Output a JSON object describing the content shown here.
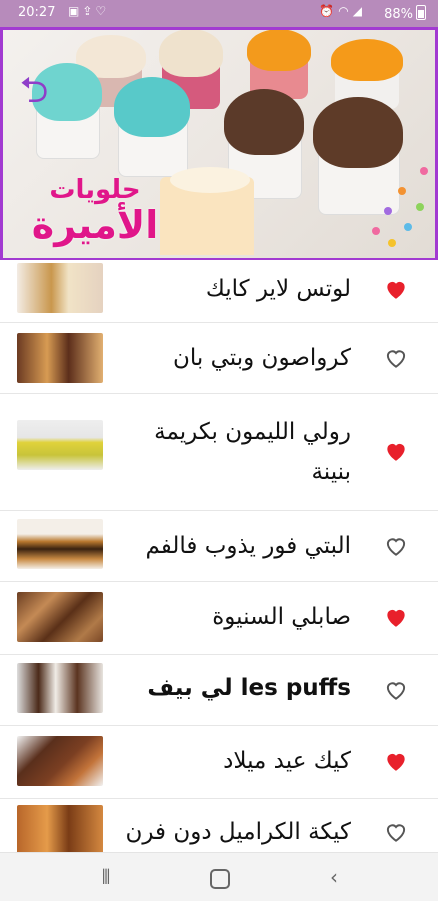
{
  "status_bar": {
    "time": "20:27",
    "left_icons": [
      "image-icon",
      "upload-icon",
      "shield-icon"
    ],
    "right_icons": [
      "alarm-icon",
      "wifi-icon",
      "signal-icon"
    ],
    "battery": "88%"
  },
  "header": {
    "logo_line1": "حلويات",
    "logo_line2": "الأميرة",
    "accent_color": "#a23ad1",
    "logo_color": "#e0168a"
  },
  "recipes": [
    {
      "title": "لوتس لاير كايك",
      "favorite": true
    },
    {
      "title": "كرواصون وبتي بان",
      "favorite": false
    },
    {
      "title": "رولي الليمون بكريمة بنينة",
      "favorite": true
    },
    {
      "title": "البتي فور يذوب فالفم",
      "favorite": false
    },
    {
      "title": "صابلي السنيوة",
      "favorite": true
    },
    {
      "title": "les puffs  لي بيف",
      "favorite": false
    },
    {
      "title": "كيك عيد ميلاد",
      "favorite": true
    },
    {
      "title": "كيكة الكراميل دون فرن",
      "favorite": false
    }
  ],
  "colors": {
    "heart_filled": "#e8202b",
    "heart_outline": "#555555",
    "status_bar": "#b78bbb"
  },
  "nav_bar": [
    "recent-apps-icon",
    "home-icon",
    "back-icon"
  ]
}
